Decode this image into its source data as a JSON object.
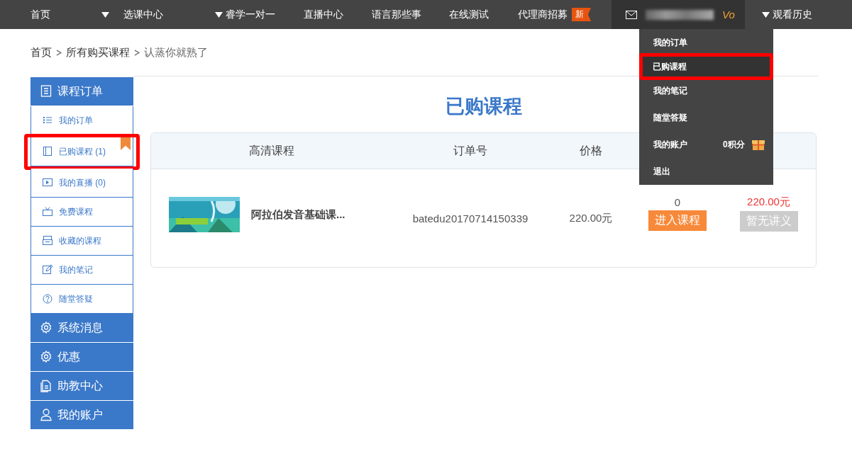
{
  "top_nav": {
    "items": [
      {
        "label": "首页",
        "dropdown": false
      },
      {
        "label": "选课中心",
        "dropdown": true
      },
      {
        "label": "睿学一对一",
        "dropdown": true
      },
      {
        "label": "直播中心",
        "dropdown": false
      },
      {
        "label": "语言那些事",
        "dropdown": false
      },
      {
        "label": "在线测试",
        "dropdown": false
      },
      {
        "label": "代理商招募",
        "dropdown": false,
        "badge": "新"
      }
    ],
    "user": {
      "level": "Vo"
    },
    "history": {
      "label": "观看历史",
      "dropdown": true
    }
  },
  "user_menu": {
    "items": [
      {
        "label": "我的订单",
        "selected": false,
        "highlighted": false
      },
      {
        "label": "已购课程",
        "selected": true,
        "highlighted": true
      },
      {
        "label": "我的笔记",
        "selected": false,
        "highlighted": false
      },
      {
        "label": "随堂答疑",
        "selected": false,
        "highlighted": false
      },
      {
        "label": "我的账户",
        "selected": false,
        "highlighted": false,
        "points": "0积分"
      },
      {
        "label": "退出",
        "selected": false,
        "highlighted": false
      }
    ]
  },
  "breadcrumb": [
    "首页",
    "所有购买课程",
    "认蒸你就熟了"
  ],
  "sidebar": {
    "groups": [
      {
        "title": "课程订单",
        "items": [
          {
            "label": "我的订单",
            "selected": false,
            "highlighted": false
          },
          {
            "label": "已购课程 (1)",
            "selected": true,
            "highlighted": true
          },
          {
            "label": "我的直播 (0)",
            "selected": false,
            "highlighted": false
          },
          {
            "label": "免费课程",
            "selected": false,
            "highlighted": false
          },
          {
            "label": "收藏的课程",
            "selected": false,
            "highlighted": false
          },
          {
            "label": "我的笔记",
            "selected": false,
            "highlighted": false
          },
          {
            "label": "随堂答疑",
            "selected": false,
            "highlighted": false
          }
        ]
      },
      {
        "title": "系统消息"
      },
      {
        "title": "优惠"
      },
      {
        "title": "助教中心"
      },
      {
        "title": "我的账户"
      }
    ]
  },
  "page_title": "已购课程",
  "table": {
    "columns": [
      "高清课程",
      "订单号",
      "价格"
    ],
    "rows": [
      {
        "title": "阿拉伯发音基础课...",
        "order_no": "batedu20170714150339",
        "price": "220.00元",
        "count": "0",
        "total": "220.00元",
        "enter_button": "进入课程",
        "notes_button": "暂无讲义",
        "notes_disabled": true
      }
    ]
  }
}
